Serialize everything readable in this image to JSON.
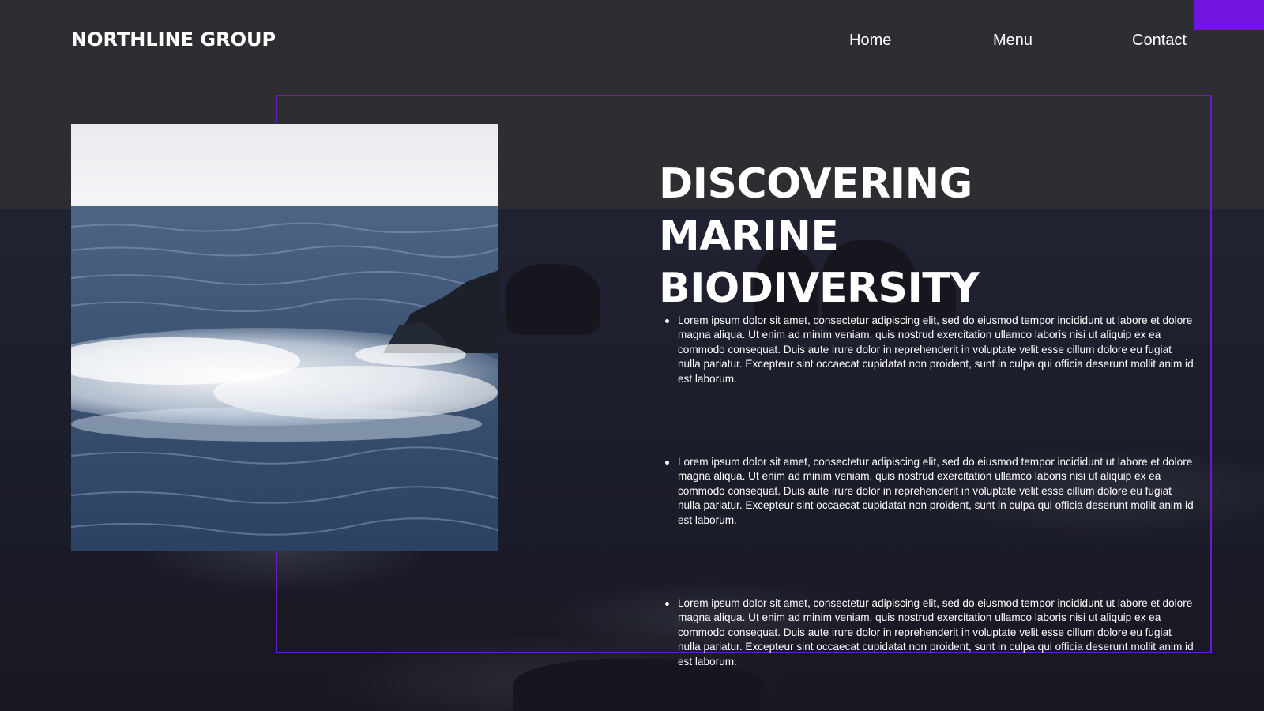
{
  "brand": {
    "logo_text": "NORTHLINE GROUP",
    "accent_color": "#7414e0",
    "frame_color": "#6a1bc8"
  },
  "nav": {
    "items": [
      "Home",
      "Menu",
      "Contact"
    ]
  },
  "hero": {
    "title_line1": "DISCOVERING MARINE",
    "title_line2": "BIODIVERSITY",
    "image_icon": "ocean-waves-photo"
  },
  "content": {
    "bullets": [
      "Lorem ipsum dolor sit amet, consectetur adipiscing elit, sed do eiusmod tempor incididunt ut labore et dolore magna aliqua. Ut enim ad minim veniam, quis nostrud exercitation ullamco laboris nisi ut aliquip ex ea commodo consequat. Duis aute irure dolor in reprehenderit in voluptate velit esse cillum dolore eu fugiat nulla pariatur. Excepteur sint occaecat cupidatat non proident, sunt in culpa qui officia deserunt mollit anim id est laborum.",
      "Lorem ipsum dolor sit amet, consectetur adipiscing elit, sed do eiusmod tempor incididunt ut labore et dolore magna aliqua. Ut enim ad minim veniam, quis nostrud exercitation ullamco laboris nisi ut aliquip ex ea commodo consequat. Duis aute irure dolor in reprehenderit in voluptate velit esse cillum dolore eu fugiat nulla pariatur. Excepteur sint occaecat cupidatat non proident, sunt in culpa qui officia deserunt mollit anim id est laborum.",
      "Lorem ipsum dolor sit amet, consectetur adipiscing elit, sed do eiusmod tempor incididunt ut labore et dolore magna aliqua. Ut enim ad minim veniam, quis nostrud exercitation ullamco laboris nisi ut aliquip ex ea commodo consequat. Duis aute irure dolor in reprehenderit in voluptate velit esse cillum dolore eu fugiat nulla pariatur. Excepteur sint occaecat cupidatat non proident, sunt in culpa qui officia deserunt mollit anim id est laborum."
    ]
  }
}
